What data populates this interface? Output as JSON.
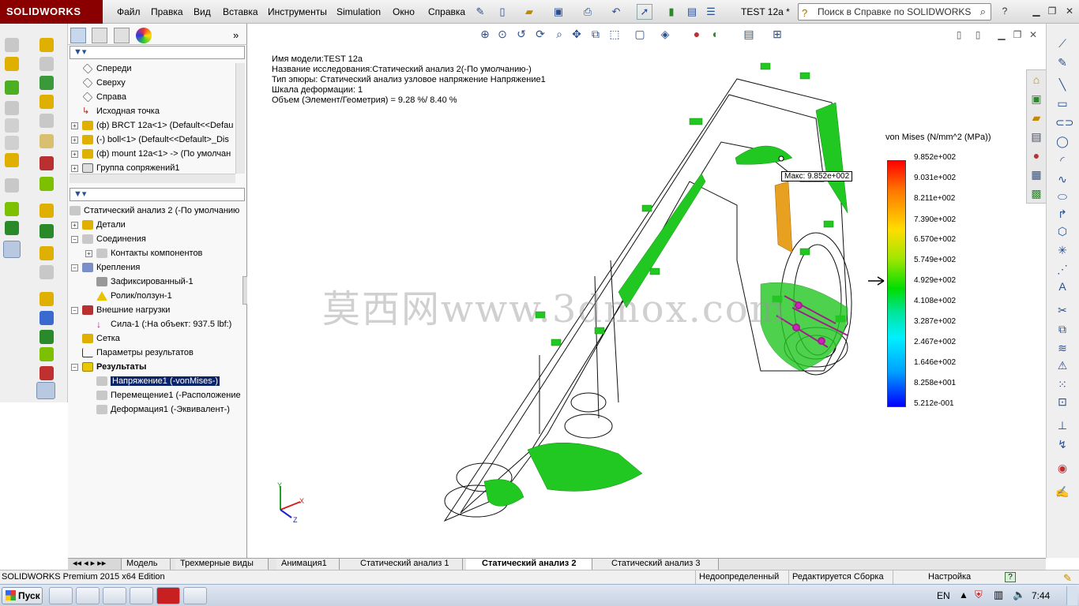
{
  "app": {
    "logo_text": "SOLIDWORKS",
    "document_title": "TEST 12a *",
    "menu": [
      "Файл",
      "Правка",
      "Вид",
      "Вставка",
      "Инструменты",
      "Simulation",
      "Окно",
      "Справка"
    ],
    "search_placeholder": "Поиск в Справке по SOLIDWORKS",
    "brand_color": "#8a0000"
  },
  "feature_tree_top": {
    "items": [
      {
        "label": "Спереди",
        "icon": "plane-icon"
      },
      {
        "label": "Сверху",
        "icon": "plane-icon"
      },
      {
        "label": "Справа",
        "icon": "plane-icon"
      },
      {
        "label": "Исходная точка",
        "icon": "origin-icon"
      },
      {
        "label": "(ф) BRCT 12a<1> (Default<<Defau",
        "icon": "part-icon"
      },
      {
        "label": "(-) boll<1> (Default<<Default>_Dis",
        "icon": "part-icon"
      },
      {
        "label": "(ф) mount 12a<1> -> (По умолчан",
        "icon": "part-icon"
      },
      {
        "label": "Группа сопряжений1",
        "icon": "mates-icon"
      }
    ]
  },
  "study_tree": {
    "root": "Статический анализ 2 (-По умолчанию",
    "items": [
      {
        "label": "Детали"
      },
      {
        "label": "Соединения"
      },
      {
        "label": "Контакты компонентов"
      },
      {
        "label": "Крепления"
      },
      {
        "label": "Зафиксированный-1"
      },
      {
        "label": "Ролик/ползун-1"
      },
      {
        "label": "Внешние нагрузки"
      },
      {
        "label": "Сила-1 (:На объект: 937.5 lbf:)"
      },
      {
        "label": "Сетка"
      },
      {
        "label": "Параметры результатов"
      },
      {
        "label": "Результаты"
      },
      {
        "label": "Напряжение1 (-vonMises-)"
      },
      {
        "label": "Перемещение1 (-Расположение"
      },
      {
        "label": "Деформация1 (-Эквивалент-)"
      }
    ]
  },
  "plot_info": {
    "line1": "Имя модели:TEST 12a",
    "line2": "Название исследования:Статический анализ 2(-По умолчанию-)",
    "line3": "Тип эпюры: Статический анализ узловое напряжение Напряжение1",
    "line4": "Шкала деформации: 1",
    "line5": "Объем (Элемент/Геометрия) = 9.28 %/ 8.40 %"
  },
  "legend": {
    "title": "von Mises (N/mm^2 (MPa))",
    "values": [
      "9.852e+002",
      "9.031e+002",
      "8.211e+002",
      "7.390e+002",
      "6.570e+002",
      "5.749e+002",
      "4.929e+002",
      "4.108e+002",
      "3.287e+002",
      "2.467e+002",
      "1.646e+002",
      "8.258e+001",
      "5.212e-001"
    ],
    "max_label": "Макс:",
    "max_value": "9.852e+002"
  },
  "watermark": "莫西网www.3dmox.com",
  "triad": {
    "x": "X",
    "y": "Y",
    "z": "Z"
  },
  "tabs": [
    "Модель",
    "Трехмерные виды",
    "Анимация1",
    "Статический анализ 1",
    "Статический анализ 2",
    "Статический анализ 3"
  ],
  "active_tab_index": 4,
  "status": {
    "edition": "SOLIDWORKS Premium 2015 x64 Edition",
    "definition": "Недоопределенный",
    "editing": "Редактируется Сборка",
    "settings": "Настройка"
  },
  "taskbar": {
    "start": "Пуск",
    "lang": "EN",
    "time": "7:44"
  }
}
